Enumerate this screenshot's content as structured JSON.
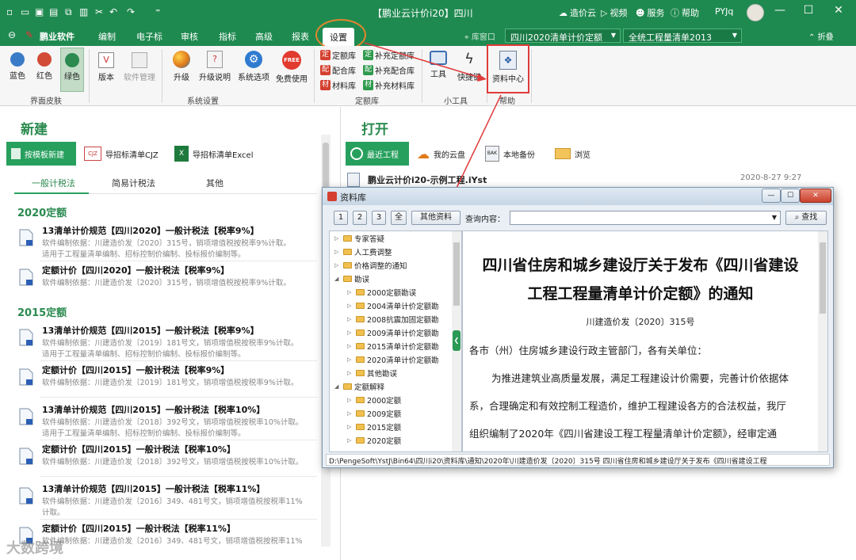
{
  "titlebar": {
    "title": "【鹏业云计价i20】四川",
    "cloud": "造价云",
    "video": "视频",
    "service": "服务",
    "help": "帮助",
    "user": "PYJq"
  },
  "menu": {
    "brand": "鹏业软件",
    "tabs": [
      "编制",
      "电子标",
      "审核",
      "指标",
      "高级",
      "报表",
      "设置"
    ],
    "active_tab": "设置",
    "quota_window": "库窗口",
    "quota_select": "四川2020清单计价定额",
    "list_select": "全统工程量清单2013",
    "collapse": "折叠"
  },
  "ribbon": {
    "skins": [
      "蓝色",
      "红色",
      "绿色"
    ],
    "skin_group": "界面皮肤",
    "version": "版本",
    "software_mgmt": "软件管理",
    "upgrade": "升级",
    "upgrade_desc": "升级说明",
    "sys_options": "系统选项",
    "free_use": "免费使用",
    "sys_group": "系统设置",
    "quota_lib": "定额库",
    "supp_quota_lib": "补充定额库",
    "mix_lib": "配合库",
    "supp_mix_lib": "补充配合库",
    "material_lib": "材料库",
    "supp_material_lib": "补充材料库",
    "quota_group": "定额库",
    "tools": "工具",
    "shortcut": "快捷键",
    "tools_group": "小工具",
    "data_center": "资料中心",
    "help_group": "帮助"
  },
  "new_panel": {
    "heading": "新建",
    "btn_template": "按模板新建",
    "btn_import_cjz": "导招标清单CJZ",
    "btn_import_excel": "导招标清单Excel",
    "subtabs": [
      "一般计税法",
      "简易计税法",
      "其他"
    ],
    "section_2020": "2020定额",
    "section_2015": "2015定额",
    "items": [
      {
        "title": "13清单计价规范【四川2020】一般计税法【税率9%】",
        "desc1": "软件编制依据：川建造价发〔2020〕315号，销项增值税按税率9%计取。",
        "desc2": "适用于工程量清单编制、招标控制价编制、投标报价编制等。"
      },
      {
        "title": "定额计价【四川2020】一般计税法【税率9%】",
        "desc1": "软件编制依据：川建造价发〔2020〕315号，销项增值税按税率9%计取。",
        "desc2": ""
      },
      {
        "title": "13清单计价规范【四川2015】一般计税法【税率9%】",
        "desc1": "软件编制依据：川建造价发〔2019〕181号文，销项增值税按税率9%计取。",
        "desc2": "适用于工程量清单编制、招标控制价编制、投标报价编制等。"
      },
      {
        "title": "定额计价【四川2015】一般计税法【税率9%】",
        "desc1": "软件编制依据：川建造价发〔2019〕181号文，销项增值税按税率9%计取。",
        "desc2": ""
      },
      {
        "title": "13清单计价规范【四川2015】一般计税法【税率10%】",
        "desc1": "软件编制依据：川建造价发〔2018〕392号文，销项增值税按税率10%计取。",
        "desc2": "适用于工程量清单编制、招标控制价编制、投标报价编制等。"
      },
      {
        "title": "定额计价【四川2015】一般计税法【税率10%】",
        "desc1": "软件编制依据：川建造价发〔2018〕392号文，销项增值税按税率10%计取。",
        "desc2": ""
      },
      {
        "title": "13清单计价规范【四川2015】一般计税法【税率11%】",
        "desc1": "软件编制依据：川建造价发〔2016〕349、481号文，销项增值税按税率11%",
        "desc2": "计取。"
      },
      {
        "title": "定额计价【四川2015】一般计税法【税率11%】",
        "desc1": "软件编制依据：川建造价发〔2016〕349、481号文，销项增值税按税率11%",
        "desc2": ""
      }
    ]
  },
  "open_panel": {
    "heading": "打开",
    "btn_recent": "最近工程",
    "btn_cloud": "我的云盘",
    "btn_backup": "本地备份",
    "btn_browse": "浏览",
    "recent_name": "鹏业云计价i20-示例工程.iYst",
    "recent_date": "2020-8-27 9:27"
  },
  "dialog": {
    "title": "资料库",
    "tab_buttons": [
      "1",
      "2",
      "3",
      "全"
    ],
    "other_btn": "其他资料",
    "query_label": "查询内容：",
    "query_value": "",
    "search_btn": "查找",
    "tree": [
      {
        "label": "专家答疑",
        "level": 0,
        "expanded": false
      },
      {
        "label": "人工费调整",
        "level": 0,
        "expanded": false
      },
      {
        "label": "价格调整的通知",
        "level": 0,
        "expanded": false
      },
      {
        "label": "勘误",
        "level": 0,
        "expanded": true
      },
      {
        "label": "2000定额勘误",
        "level": 1,
        "expanded": false
      },
      {
        "label": "2004清单计价定额勘",
        "level": 1,
        "expanded": false
      },
      {
        "label": "2008抗震加固定额勘",
        "level": 1,
        "expanded": false
      },
      {
        "label": "2009清单计价定额勘",
        "level": 1,
        "expanded": false
      },
      {
        "label": "2015清单计价定额勘",
        "level": 1,
        "expanded": false
      },
      {
        "label": "2020清单计价定额勘",
        "level": 1,
        "expanded": false
      },
      {
        "label": "其他勘误",
        "level": 1,
        "expanded": false
      },
      {
        "label": "定额解释",
        "level": 0,
        "expanded": true
      },
      {
        "label": "2000定额",
        "level": 1,
        "expanded": false
      },
      {
        "label": "2009定额",
        "level": 1,
        "expanded": false
      },
      {
        "label": "2015定额",
        "level": 1,
        "expanded": false
      },
      {
        "label": "2020定额",
        "level": 1,
        "expanded": false
      }
    ],
    "doc_title_line1": "四川省住房和城乡建设厅关于发布《四川省建设",
    "doc_title_line2": "工程工程量清单计价定额》的通知",
    "doc_number": "川建造价发〔2020〕315号",
    "doc_salutation": "各市（州）住房城乡建设行政主管部门，各有关单位：",
    "doc_p1": "为推进建筑业高质量发展，满足工程建设计价需要，完善计价依据体",
    "doc_p2": "系，合理确定和有效控制工程造价，维护工程建设各方的合法权益，我厅",
    "doc_p3": "组织编制了2020年《四川省建设工程工程量清单计价定额》，经审定通",
    "status_path": "D:\\PengeSoft\\YstJ\\Bin64\\四川i20\\资料库\\通知\\2020年\\川建造价发〔2020〕315号 四川省住房和城乡建设厅关于发布《四川省建设工程"
  },
  "watermark": "大数跨境",
  "colors": {
    "brand_green": "#1f8a50",
    "accent_green": "#27a05d",
    "highlight_red": "#e03b3b",
    "highlight_orange": "#e3862e"
  }
}
